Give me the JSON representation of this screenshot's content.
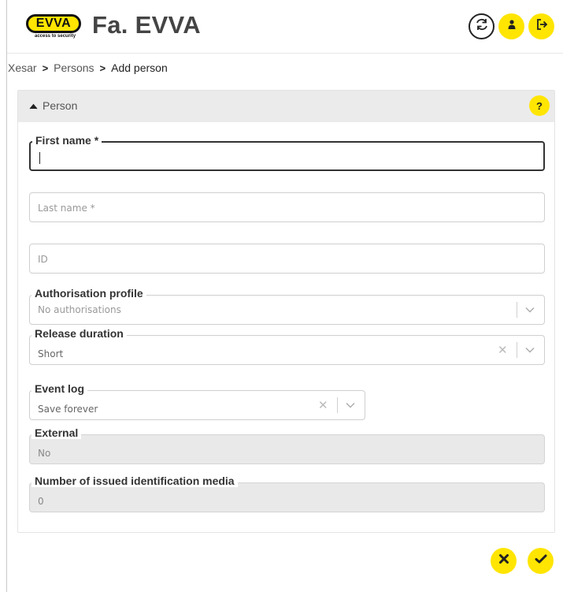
{
  "header": {
    "logo_text": "EVVA",
    "logo_tagline": "access to security",
    "title": "Fa. EVVA"
  },
  "breadcrumb": [
    "Xesar",
    "Persons",
    "Add person"
  ],
  "panel": {
    "title": "Person",
    "help_label": "?"
  },
  "form": {
    "first_name_label": "First name *",
    "first_name_value": "",
    "last_name_placeholder": "Last name *",
    "id_placeholder": "ID",
    "authorisation_profile_label": "Authorisation profile",
    "authorisation_profile_placeholder": "No authorisations",
    "release_duration_label": "Release duration",
    "release_duration_value": "Short",
    "event_log_label": "Event log",
    "event_log_value": "Save forever",
    "external_label": "External",
    "external_value": "No",
    "issued_media_label": "Number of issued identification media",
    "issued_media_value": "0"
  },
  "colors": {
    "accent": "#ffe500",
    "panel_header": "#ebebeb",
    "disabled_field": "#e9e9e9"
  },
  "icons": [
    "sync-icon",
    "user-icon",
    "logout-icon",
    "help-icon",
    "chevron-up-icon",
    "chevron-down-icon",
    "clear-icon",
    "close-icon",
    "check-icon"
  ]
}
